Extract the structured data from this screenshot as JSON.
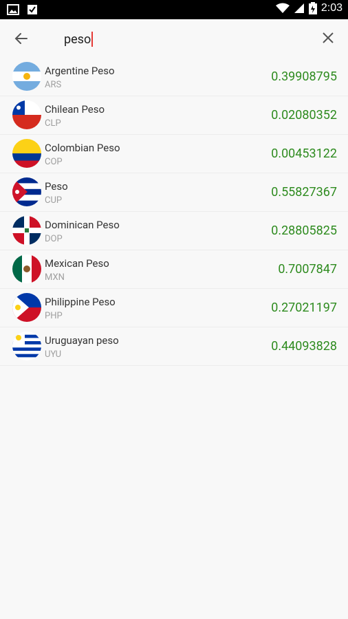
{
  "status_bar": {
    "time": "2:03"
  },
  "search": {
    "query": "peso"
  },
  "currencies": [
    {
      "name": "Argentine Peso",
      "code": "ARS",
      "rate": "0.39908795",
      "flag": "argentina-flag-icon"
    },
    {
      "name": "Chilean Peso",
      "code": "CLP",
      "rate": "0.02080352",
      "flag": "chile-flag-icon"
    },
    {
      "name": "Colombian Peso",
      "code": "COP",
      "rate": "0.00453122",
      "flag": "colombia-flag-icon"
    },
    {
      "name": "Peso",
      "code": "CUP",
      "rate": "0.55827367",
      "flag": "cuba-flag-icon"
    },
    {
      "name": "Dominican Peso",
      "code": "DOP",
      "rate": "0.28805825",
      "flag": "dominican-republic-flag-icon"
    },
    {
      "name": "Mexican Peso",
      "code": "MXN",
      "rate": "0.7007847",
      "flag": "mexico-flag-icon"
    },
    {
      "name": "Philippine Peso",
      "code": "PHP",
      "rate": "0.27021197",
      "flag": "philippines-flag-icon"
    },
    {
      "name": "Uruguayan peso",
      "code": "UYU",
      "rate": "0.44093828",
      "flag": "uruguay-flag-icon"
    }
  ],
  "colors": {
    "rate": "#2e8b1f",
    "cursor": "#e53935"
  }
}
